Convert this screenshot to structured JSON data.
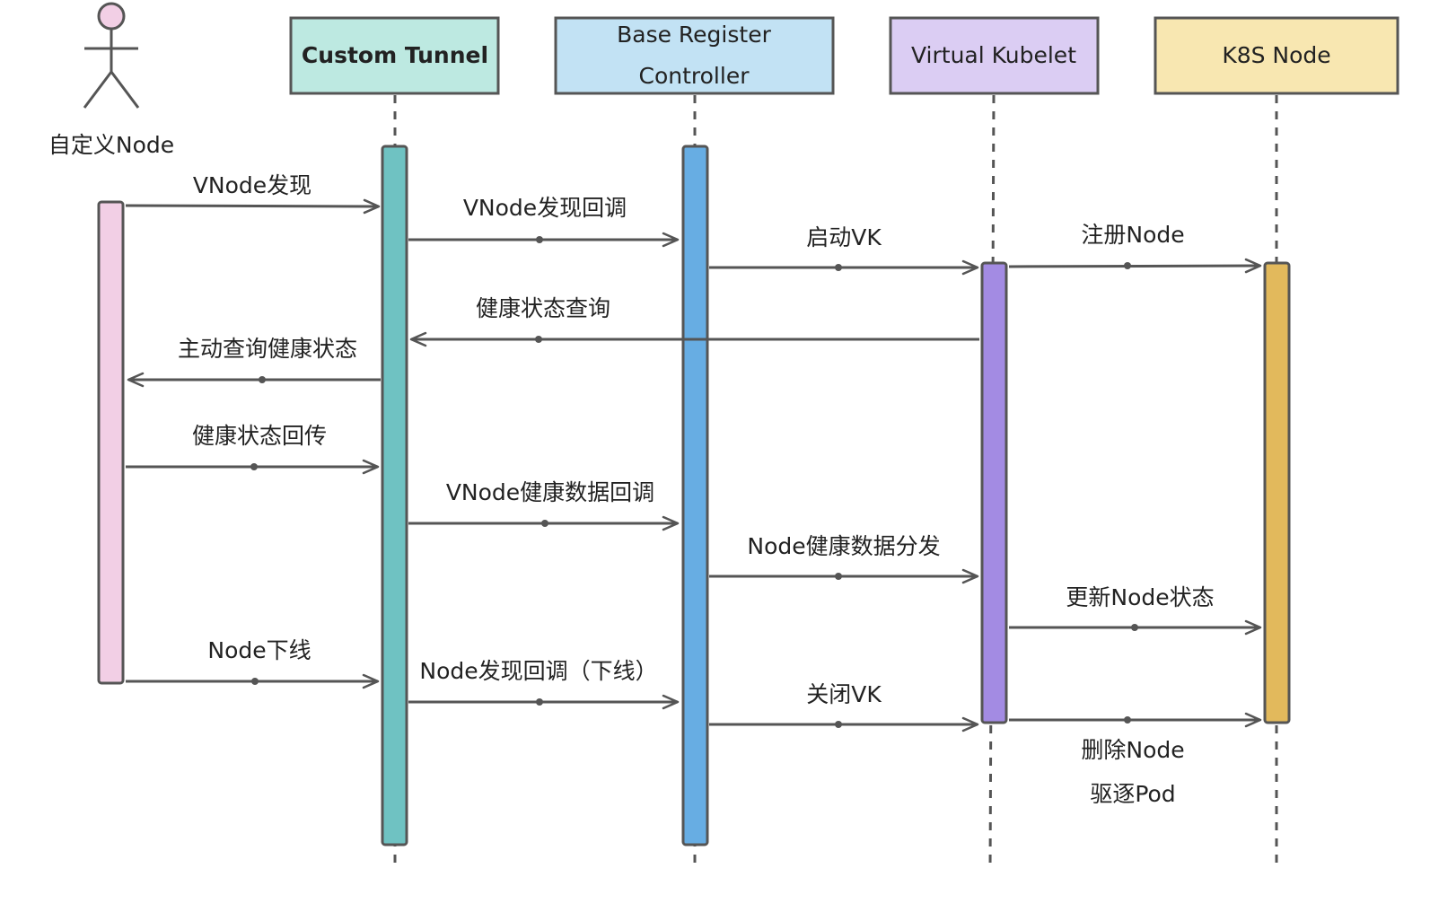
{
  "actor": {
    "label": "自定义Node",
    "color": "#f2cfe5"
  },
  "participants": [
    {
      "id": "custom_tunnel",
      "label_lines": [
        "Custom Tunnel"
      ],
      "bold": true,
      "box_fill": "#bde9e1",
      "activation_fill": "#6fc2c2"
    },
    {
      "id": "base_register_controller",
      "label_lines": [
        "Base Register",
        "Controller"
      ],
      "bold": false,
      "box_fill": "#c2e2f4",
      "activation_fill": "#67ade3"
    },
    {
      "id": "virtual_kubelet",
      "label_lines": [
        "Virtual Kubelet"
      ],
      "bold": false,
      "box_fill": "#dbcdf3",
      "activation_fill": "#a38be3"
    },
    {
      "id": "k8s_node",
      "label_lines": [
        "K8S Node"
      ],
      "bold": false,
      "box_fill": "#f8e7b1",
      "activation_fill": "#e2b95c"
    }
  ],
  "messages": [
    {
      "id": "vnode-discover",
      "label_lines": [
        "VNode发现"
      ],
      "from": "custom_node",
      "to": "custom_tunnel"
    },
    {
      "id": "vnode-discover-callback",
      "label_lines": [
        "VNode发现回调"
      ],
      "from": "custom_tunnel",
      "to": "base_register_controller"
    },
    {
      "id": "start-vk",
      "label_lines": [
        "启动VK"
      ],
      "from": "base_register_controller",
      "to": "virtual_kubelet"
    },
    {
      "id": "register-node",
      "label_lines": [
        "注册Node"
      ],
      "from": "virtual_kubelet",
      "to": "k8s_node"
    },
    {
      "id": "health-query",
      "label_lines": [
        "健康状态查询"
      ],
      "from": "virtual_kubelet",
      "to": "custom_tunnel"
    },
    {
      "id": "active-health-query",
      "label_lines": [
        "主动查询健康状态"
      ],
      "from": "custom_tunnel",
      "to": "custom_node"
    },
    {
      "id": "health-report",
      "label_lines": [
        "健康状态回传"
      ],
      "from": "custom_node",
      "to": "custom_tunnel"
    },
    {
      "id": "vnode-health-callback",
      "label_lines": [
        "VNode健康数据回调"
      ],
      "from": "custom_tunnel",
      "to": "base_register_controller"
    },
    {
      "id": "node-health-dispatch",
      "label_lines": [
        "Node健康数据分发"
      ],
      "from": "base_register_controller",
      "to": "virtual_kubelet"
    },
    {
      "id": "update-node-status",
      "label_lines": [
        "更新Node状态"
      ],
      "from": "virtual_kubelet",
      "to": "k8s_node"
    },
    {
      "id": "node-offline",
      "label_lines": [
        "Node下线"
      ],
      "from": "custom_node",
      "to": "custom_tunnel"
    },
    {
      "id": "node-offline-callback",
      "label_lines": [
        "Node发现回调（下线）"
      ],
      "from": "custom_tunnel",
      "to": "base_register_controller"
    },
    {
      "id": "close-vk",
      "label_lines": [
        "关闭VK"
      ],
      "from": "base_register_controller",
      "to": "virtual_kubelet"
    },
    {
      "id": "delete-node-evict-pod",
      "label_lines": [
        "删除Node",
        "驱逐Pod"
      ],
      "from": "virtual_kubelet",
      "to": "k8s_node"
    }
  ],
  "colors": {
    "line": "#555555",
    "box_stroke": "#555555",
    "text": "#222222"
  }
}
